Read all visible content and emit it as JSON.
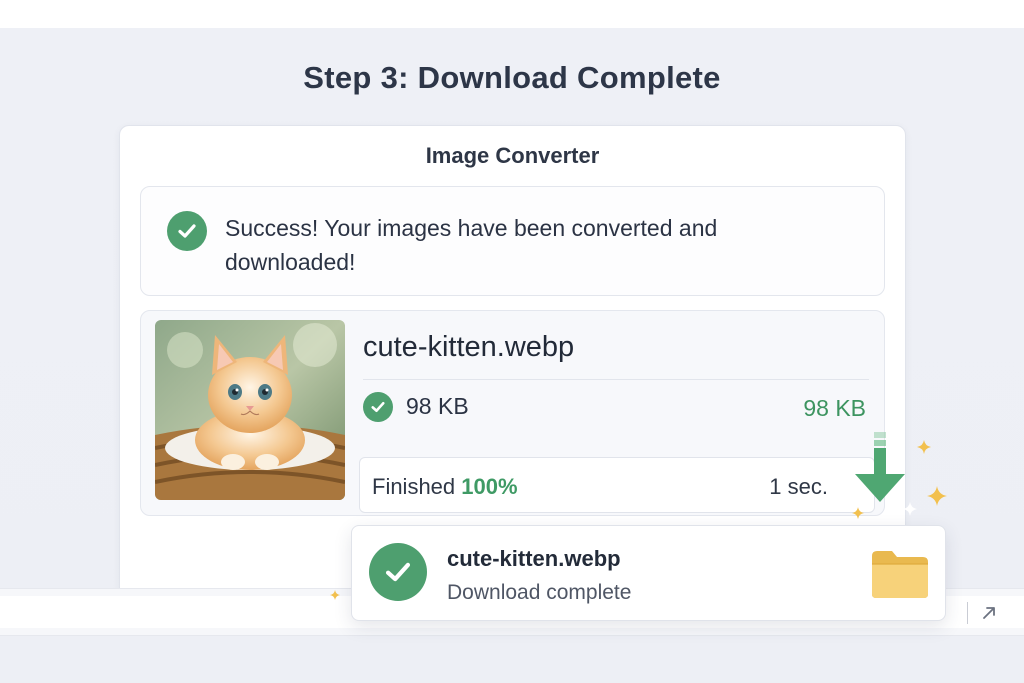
{
  "page": {
    "step_title": "Step 3: Download Complete"
  },
  "converter": {
    "title": "Image Converter",
    "success_message": "Success! Your images have been converted and downloaded!",
    "file": {
      "name": "cute-kitten.webp",
      "size_original": "98 KB",
      "size_converted": "98 KB",
      "progress_label": "Finished",
      "progress_percent": "100%",
      "elapsed": "1 sec."
    }
  },
  "download_toast": {
    "file_name": "cute-kitten.webp",
    "status": "Download complete"
  },
  "colors": {
    "success_green": "#4e9f6f",
    "accent_green_text": "#3d9460",
    "folder_yellow": "#f7d27a",
    "background": "#eef0f6"
  },
  "icons": {
    "success": "check-circle-icon",
    "download": "download-arrow-icon",
    "folder": "folder-icon",
    "expand": "expand-arrow-icon"
  }
}
